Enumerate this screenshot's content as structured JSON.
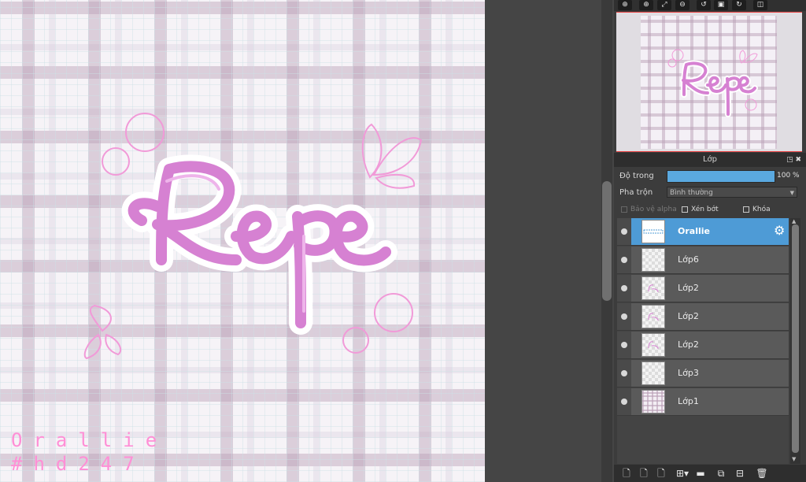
{
  "canvas": {
    "watermark_line1": "Orallie",
    "watermark_line2": "#hd247",
    "accent_color": "#e07ad2"
  },
  "navigator": {
    "tools": [
      "zoom-fit-icon",
      "zoom-in-icon",
      "fit-screen-icon",
      "zoom-out-icon",
      "rotate-left-icon",
      "actual-size-icon",
      "rotate-right-icon",
      "flip-icon"
    ]
  },
  "layer_panel": {
    "title": "Lớp",
    "opacity_label": "Độ trong",
    "opacity_value": "100 %",
    "opacity_fraction": 1.0,
    "blend_label": "Pha trộn",
    "blend_value": "Bình thường",
    "protect_alpha": "Bảo vệ alpha",
    "clipping": "Xén bớt",
    "lock": "Khóa",
    "layers": [
      {
        "name": "Orallie",
        "selected": true
      },
      {
        "name": "Lớp6",
        "selected": false
      },
      {
        "name": "Lớp2",
        "selected": false
      },
      {
        "name": "Lớp2",
        "selected": false
      },
      {
        "name": "Lớp2",
        "selected": false
      },
      {
        "name": "Lớp3",
        "selected": false
      },
      {
        "name": "Lớp1",
        "selected": false
      }
    ]
  },
  "bottom_tools": [
    "new-layer-icon",
    "new-halftone-layer-icon",
    "new-folder-layer-icon",
    "add-layer-menu-icon",
    "folder-icon",
    "duplicate-layer-icon",
    "merge-layer-icon",
    "delete-layer-icon"
  ]
}
